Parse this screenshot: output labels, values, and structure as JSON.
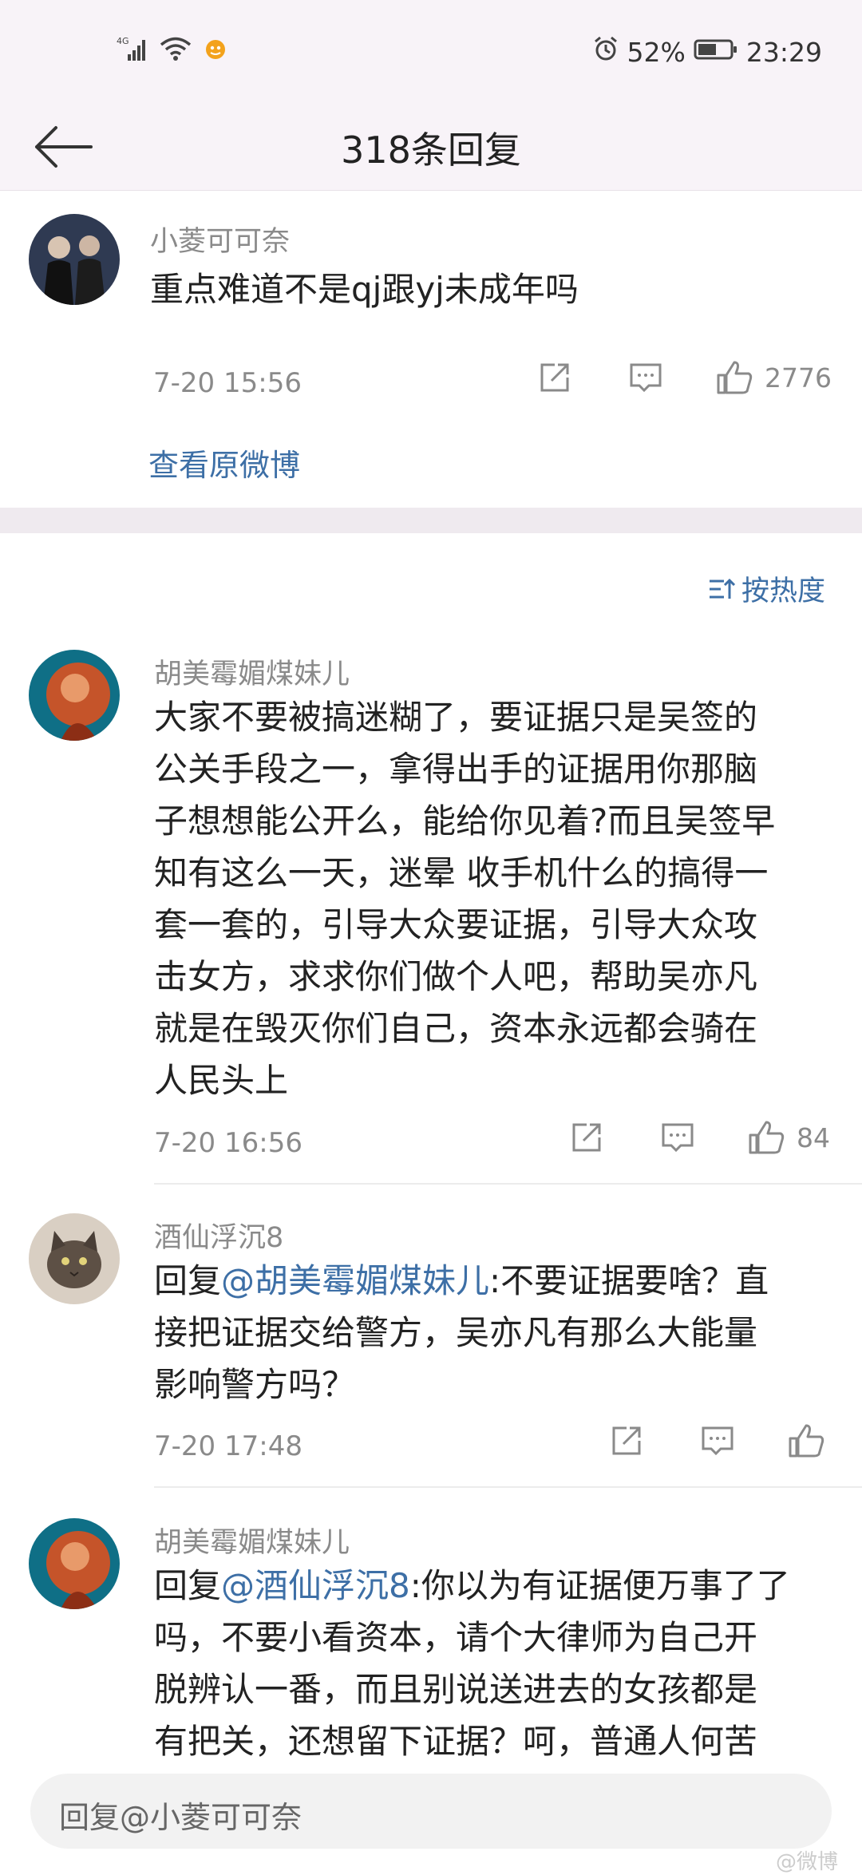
{
  "status": {
    "network": "4G",
    "battery": "52%",
    "time": "23:29"
  },
  "header": {
    "title": "318条回复"
  },
  "original": {
    "username": "小菱可可奈",
    "text": "重点难道不是qj跟yj未成年吗",
    "time": "7-20 15:56",
    "likes": "2776",
    "view_original": "查看原微博"
  },
  "sort_label": "按热度",
  "replies": [
    {
      "username": "胡美霉媚煤妹儿",
      "lines": [
        "大家不要被搞迷糊了，要证据只是吴签的",
        "公关手段之一，拿得出手的证据用你那脑",
        "子想想能公开么，能给你见着?而且吴签早",
        "知有这么一天，迷晕 收手机什么的搞得一",
        "套一套的，引导大众要证据，引导大众攻",
        "击女方，求求你们做个人吧，帮助吴亦凡",
        "就是在毁灭你们自己，资本永远都会骑在",
        "人民头上"
      ],
      "time": "7-20 16:56",
      "likes": "84"
    },
    {
      "username": "酒仙浮沉8",
      "prefix": "回复",
      "mention": "@胡美霉媚煤妹儿",
      "first": ":不要证据要啥？直",
      "lines": [
        "接把证据交给警方，吴亦凡有那么大能量",
        "影响警方吗？"
      ],
      "time": "7-20 17:48"
    },
    {
      "username": "胡美霉媚煤妹儿",
      "prefix": "回复",
      "mention": "@酒仙浮沉8",
      "first": ":你以为有证据便万事了了",
      "lines": [
        "吗，不要小看资本，请个大律师为自己开",
        "脱辨认一番，而且别说送进去的女孩都是",
        "有把关，还想留下证据？呵，普通人何苦"
      ]
    }
  ],
  "reply_bar": {
    "placeholder": "回复@小菱可可奈"
  },
  "watermark": "@微博"
}
